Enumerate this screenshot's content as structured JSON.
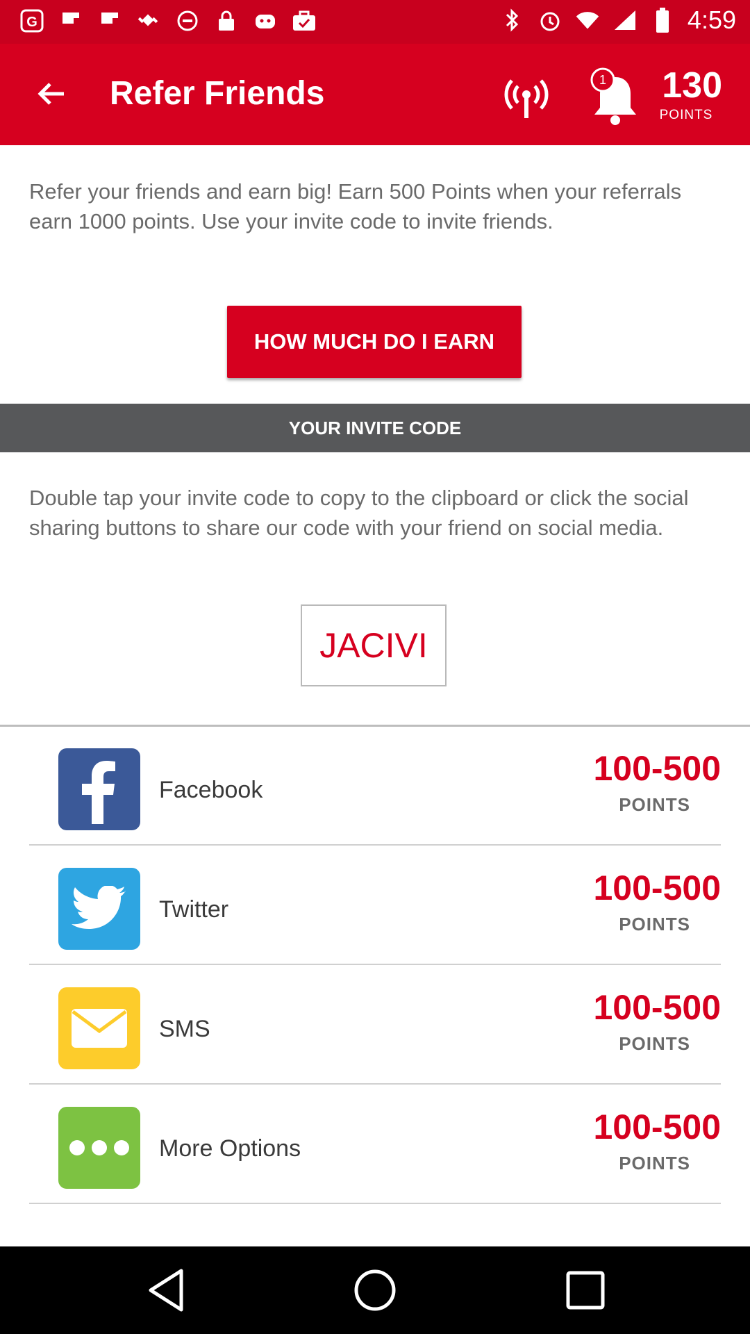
{
  "status_bar": {
    "time": "4:59",
    "left_icons": [
      "g-icon",
      "flipboard-icon",
      "flipboard-icon",
      "fake-gps-icon",
      "blocked-icon",
      "lock-icon",
      "android-icon",
      "briefcase-check-icon"
    ],
    "right_icons": [
      "bluetooth-icon",
      "alarm-icon",
      "wifi-icon",
      "signal-icon",
      "battery-icon"
    ]
  },
  "app_bar": {
    "title": "Refer Friends",
    "notification_count": "1",
    "points_value": "130",
    "points_label": "POINTS",
    "color": "#d6001f"
  },
  "intro": {
    "text": "Refer your friends and earn big! Earn 500 Points when your referrals earn 1000 points. Use your invite code to invite friends.",
    "button_label": "HOW MUCH DO I EARN"
  },
  "invite": {
    "header": "YOUR INVITE CODE",
    "help_text": "Double tap your invite code to copy to the clipboard or click the social sharing buttons to share our code with your friend on social media.",
    "code": "JACIVI"
  },
  "share_options": [
    {
      "name": "Facebook",
      "range": "100-500",
      "unit": "POINTS",
      "icon": "facebook-icon",
      "color": "#3b5998"
    },
    {
      "name": "Twitter",
      "range": "100-500",
      "unit": "POINTS",
      "icon": "twitter-icon",
      "color": "#2ea5e1"
    },
    {
      "name": "SMS",
      "range": "100-500",
      "unit": "POINTS",
      "icon": "mail-icon",
      "color": "#fdcc2b"
    },
    {
      "name": "More Options",
      "range": "100-500",
      "unit": "POINTS",
      "icon": "more-icon",
      "color": "#7dc242"
    }
  ]
}
